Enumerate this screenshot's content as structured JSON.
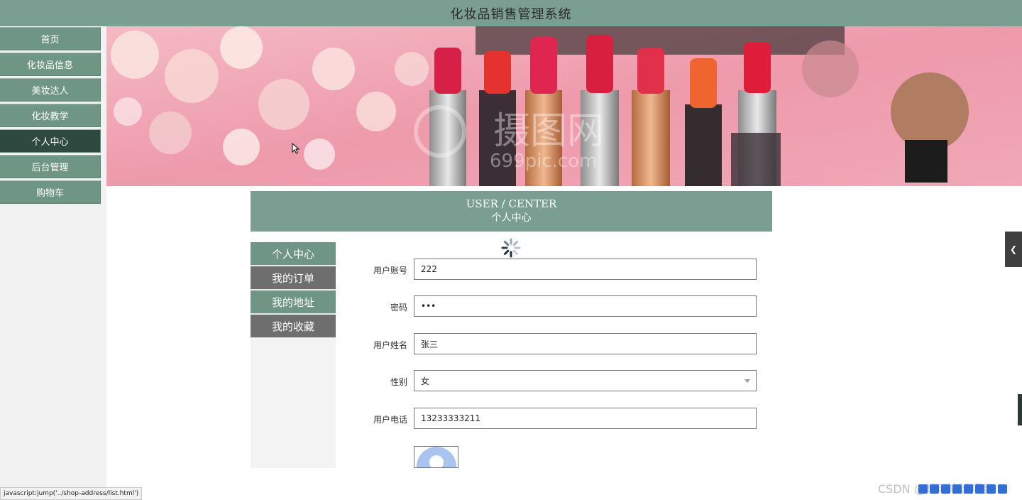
{
  "app": {
    "title": "化妆品销售管理系统"
  },
  "nav": {
    "items": [
      {
        "label": "首页"
      },
      {
        "label": "化妆品信息"
      },
      {
        "label": "美妆达人"
      },
      {
        "label": "化妆教学"
      },
      {
        "label": "个人中心",
        "active": true
      },
      {
        "label": "后台管理"
      },
      {
        "label": "购物车"
      }
    ]
  },
  "banner": {
    "watermark": "摄图网",
    "watermark_sub": "699pic.com"
  },
  "section": {
    "title_en": "USER / CENTER",
    "title_cn": "个人中心"
  },
  "subnav": {
    "items": [
      {
        "label": "个人中心"
      },
      {
        "label": "我的订单"
      },
      {
        "label": "我的地址"
      },
      {
        "label": "我的收藏"
      }
    ]
  },
  "form": {
    "username": {
      "label": "用户账号",
      "value": "222"
    },
    "password": {
      "label": "密码",
      "value": "•••"
    },
    "name": {
      "label": "用户姓名",
      "value": "张三"
    },
    "gender": {
      "label": "性别",
      "value": "女"
    },
    "phone": {
      "label": "用户电话",
      "value": "13233333211"
    }
  },
  "status_bar": {
    "text": "javascript:jump('../shop-address/list.html')"
  },
  "overlay": {
    "watermark": "CSDN @靖可毕设项目"
  },
  "colors": {
    "primary": "#7a9e92",
    "nav_item": "#6f9585",
    "nav_active": "#2e4a40",
    "sub_gray": "#6e6e6e"
  }
}
